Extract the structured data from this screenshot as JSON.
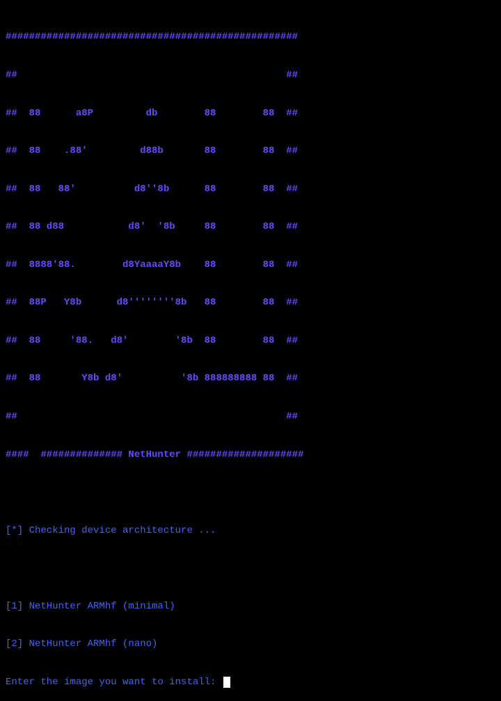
{
  "banner": {
    "lines": [
      "##################################################",
      "##                                              ##",
      "##  88      a8P         db        88        88  ##",
      "##  88    .88'         d88b       88        88  ##",
      "##  88   88'          d8''8b      88        88  ##",
      "##  88 d88           d8'  '8b     88        88  ##",
      "##  8888'88.        d8YaaaaY8b    88        88  ##",
      "##  88P   Y8b      d8''''''''8b   88        88  ##",
      "##  88     '88.   d8'        '8b  88        88  ##",
      "##  88       Y8b d8'          '8b 888888888 88  ##",
      "##                                              ##",
      "####  ############## NetHunter ####################"
    ]
  },
  "status": {
    "check_message": "[*] Checking device architecture ..."
  },
  "options": {
    "option1": "[1] NetHunter ARMhf (minimal)",
    "option2": "[2] NetHunter ARMhf (nano)"
  },
  "prompt": {
    "text": "Enter the image you want to install: "
  }
}
